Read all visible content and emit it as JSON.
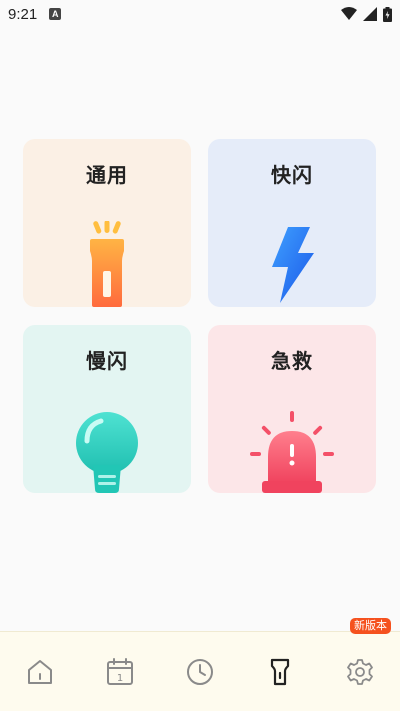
{
  "status_bar": {
    "time": "9:21",
    "notification_letter": "A"
  },
  "cards": {
    "general": {
      "label": "通用",
      "icon": "flashlight-icon"
    },
    "fast": {
      "label": "快闪",
      "icon": "lightning-icon"
    },
    "slow": {
      "label": "慢闪",
      "icon": "lightbulb-icon"
    },
    "sos": {
      "label": "急救",
      "icon": "alarm-light-icon"
    }
  },
  "bottom_nav": {
    "items": [
      {
        "icon": "home-icon",
        "active": false
      },
      {
        "icon": "calendar-icon",
        "active": false,
        "day": "1"
      },
      {
        "icon": "clock-icon",
        "active": false
      },
      {
        "icon": "flashlight-icon",
        "active": true
      },
      {
        "icon": "gear-icon",
        "active": false,
        "badge": "新版本"
      }
    ]
  },
  "colors": {
    "badge": "#f5511e",
    "nav_bg": "#fefbee",
    "general_card": "#fbf0e5",
    "fast_card": "#e5ecf9",
    "slow_card": "#e3f5f2",
    "sos_card": "#fce6e8"
  }
}
